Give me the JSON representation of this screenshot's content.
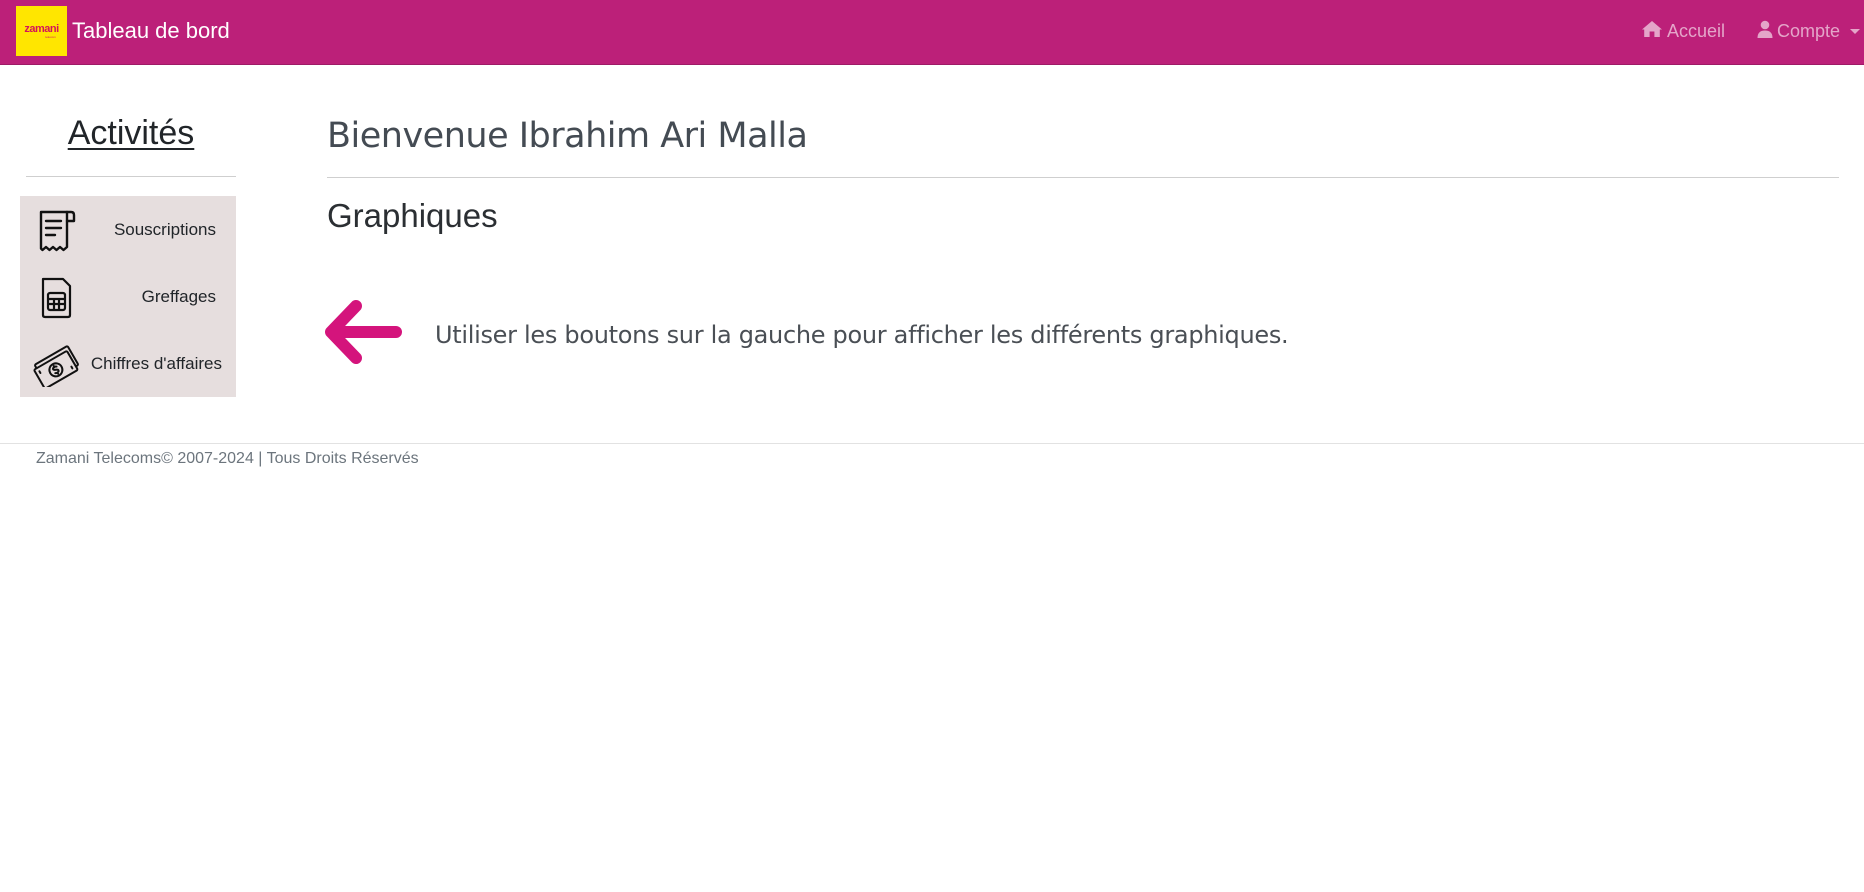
{
  "navbar": {
    "logo_text": "zamani",
    "logo_subtext": "telecom",
    "title": "Tableau de bord",
    "home_label": "Accueil",
    "account_label": "Compte",
    "background": "#bc2079"
  },
  "sidebar": {
    "title": "Activités",
    "items": [
      {
        "label": "Souscriptions",
        "icon": "receipt-icon"
      },
      {
        "label": "Greffages",
        "icon": "sim-card-icon"
      },
      {
        "label": "Chiffres d'affaires",
        "icon": "money-icon"
      }
    ]
  },
  "main": {
    "welcome": "Bienvenue Ibrahim Ari Malla",
    "section_title": "Graphiques",
    "hint_text": "Utiliser les boutons sur la gauche pour afficher les différents graphiques.",
    "hint_icon": "arrow-left-icon",
    "accent_color": "#d4147c"
  },
  "footer": {
    "text": "Zamani Telecoms© 2007-2024 | Tous Droits Réservés"
  }
}
